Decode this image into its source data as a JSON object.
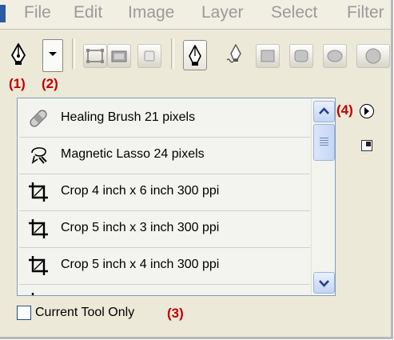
{
  "menu": {
    "items": [
      "File",
      "Edit",
      "Image",
      "Layer",
      "Select",
      "Filter"
    ]
  },
  "options_bar": {
    "tool_icon": "pen-tool-icon",
    "dropdown_icon": "chevron-down-icon",
    "shape_buttons": [
      "shape-layers-icon",
      "paths-icon",
      "fill-pixels-icon",
      "pen-icon",
      "freeform-pen-icon",
      "rectangle-icon",
      "rounded-rectangle-icon",
      "ellipse-icon",
      "polygon-icon"
    ]
  },
  "callouts": {
    "c1": "(1)",
    "c2": "(2)",
    "c3": "(3)",
    "c4": "(4)"
  },
  "presets": [
    {
      "label": "Healing Brush 21 pixels",
      "icon": "bandage-icon"
    },
    {
      "label": "Magnetic Lasso 24 pixels",
      "icon": "magnetic-lasso-icon"
    },
    {
      "label": "Crop 4 inch x 6 inch 300 ppi",
      "icon": "crop-icon"
    },
    {
      "label": "Crop 5 inch x 3 inch 300 ppi",
      "icon": "crop-icon"
    },
    {
      "label": "Crop 5 inch x 4 inch 300 ppi",
      "icon": "crop-icon"
    }
  ],
  "panel": {
    "menu_icon": "panel-menu-arrow-icon",
    "new_preset_icon": "new-preset-icon"
  },
  "footer": {
    "checkbox_label": "Current Tool Only",
    "checkbox_checked": false
  },
  "colors": {
    "callout": "#c00000",
    "list_border": "#7f9db9",
    "scrollbar": "#c4d4f3"
  }
}
